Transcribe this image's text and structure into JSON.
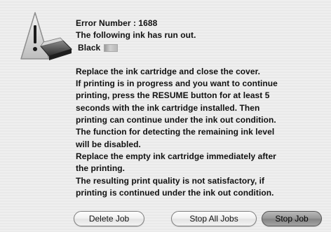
{
  "dialog": {
    "error_number": "Error Number : 1688",
    "ink_ran_out": "The following ink has run out.",
    "ink_name": "Black",
    "body_lines": [
      "Replace the ink cartridge and close the cover.",
      "If printing is in progress and you want to continue",
      "printing, press the RESUME button for at least 5",
      "seconds with the ink cartridge installed. Then",
      "printing can continue under the ink out condition.",
      "The function for detecting the remaining ink level",
      "will be disabled.",
      "Replace the empty ink cartridge immediately after",
      "the printing.",
      "The resulting print quality is not satisfactory, if",
      "printing is continued under the ink out condition."
    ]
  },
  "buttons": {
    "delete_job": "Delete Job",
    "stop_all_jobs": "Stop All Jobs",
    "stop_job": "Stop Job"
  },
  "icons": {
    "alert": "warning-printer-icon",
    "ink_swatch": "ink-swatch-icon"
  },
  "colors": {
    "background": "#ededed",
    "default_button": "#9a9a9a"
  }
}
